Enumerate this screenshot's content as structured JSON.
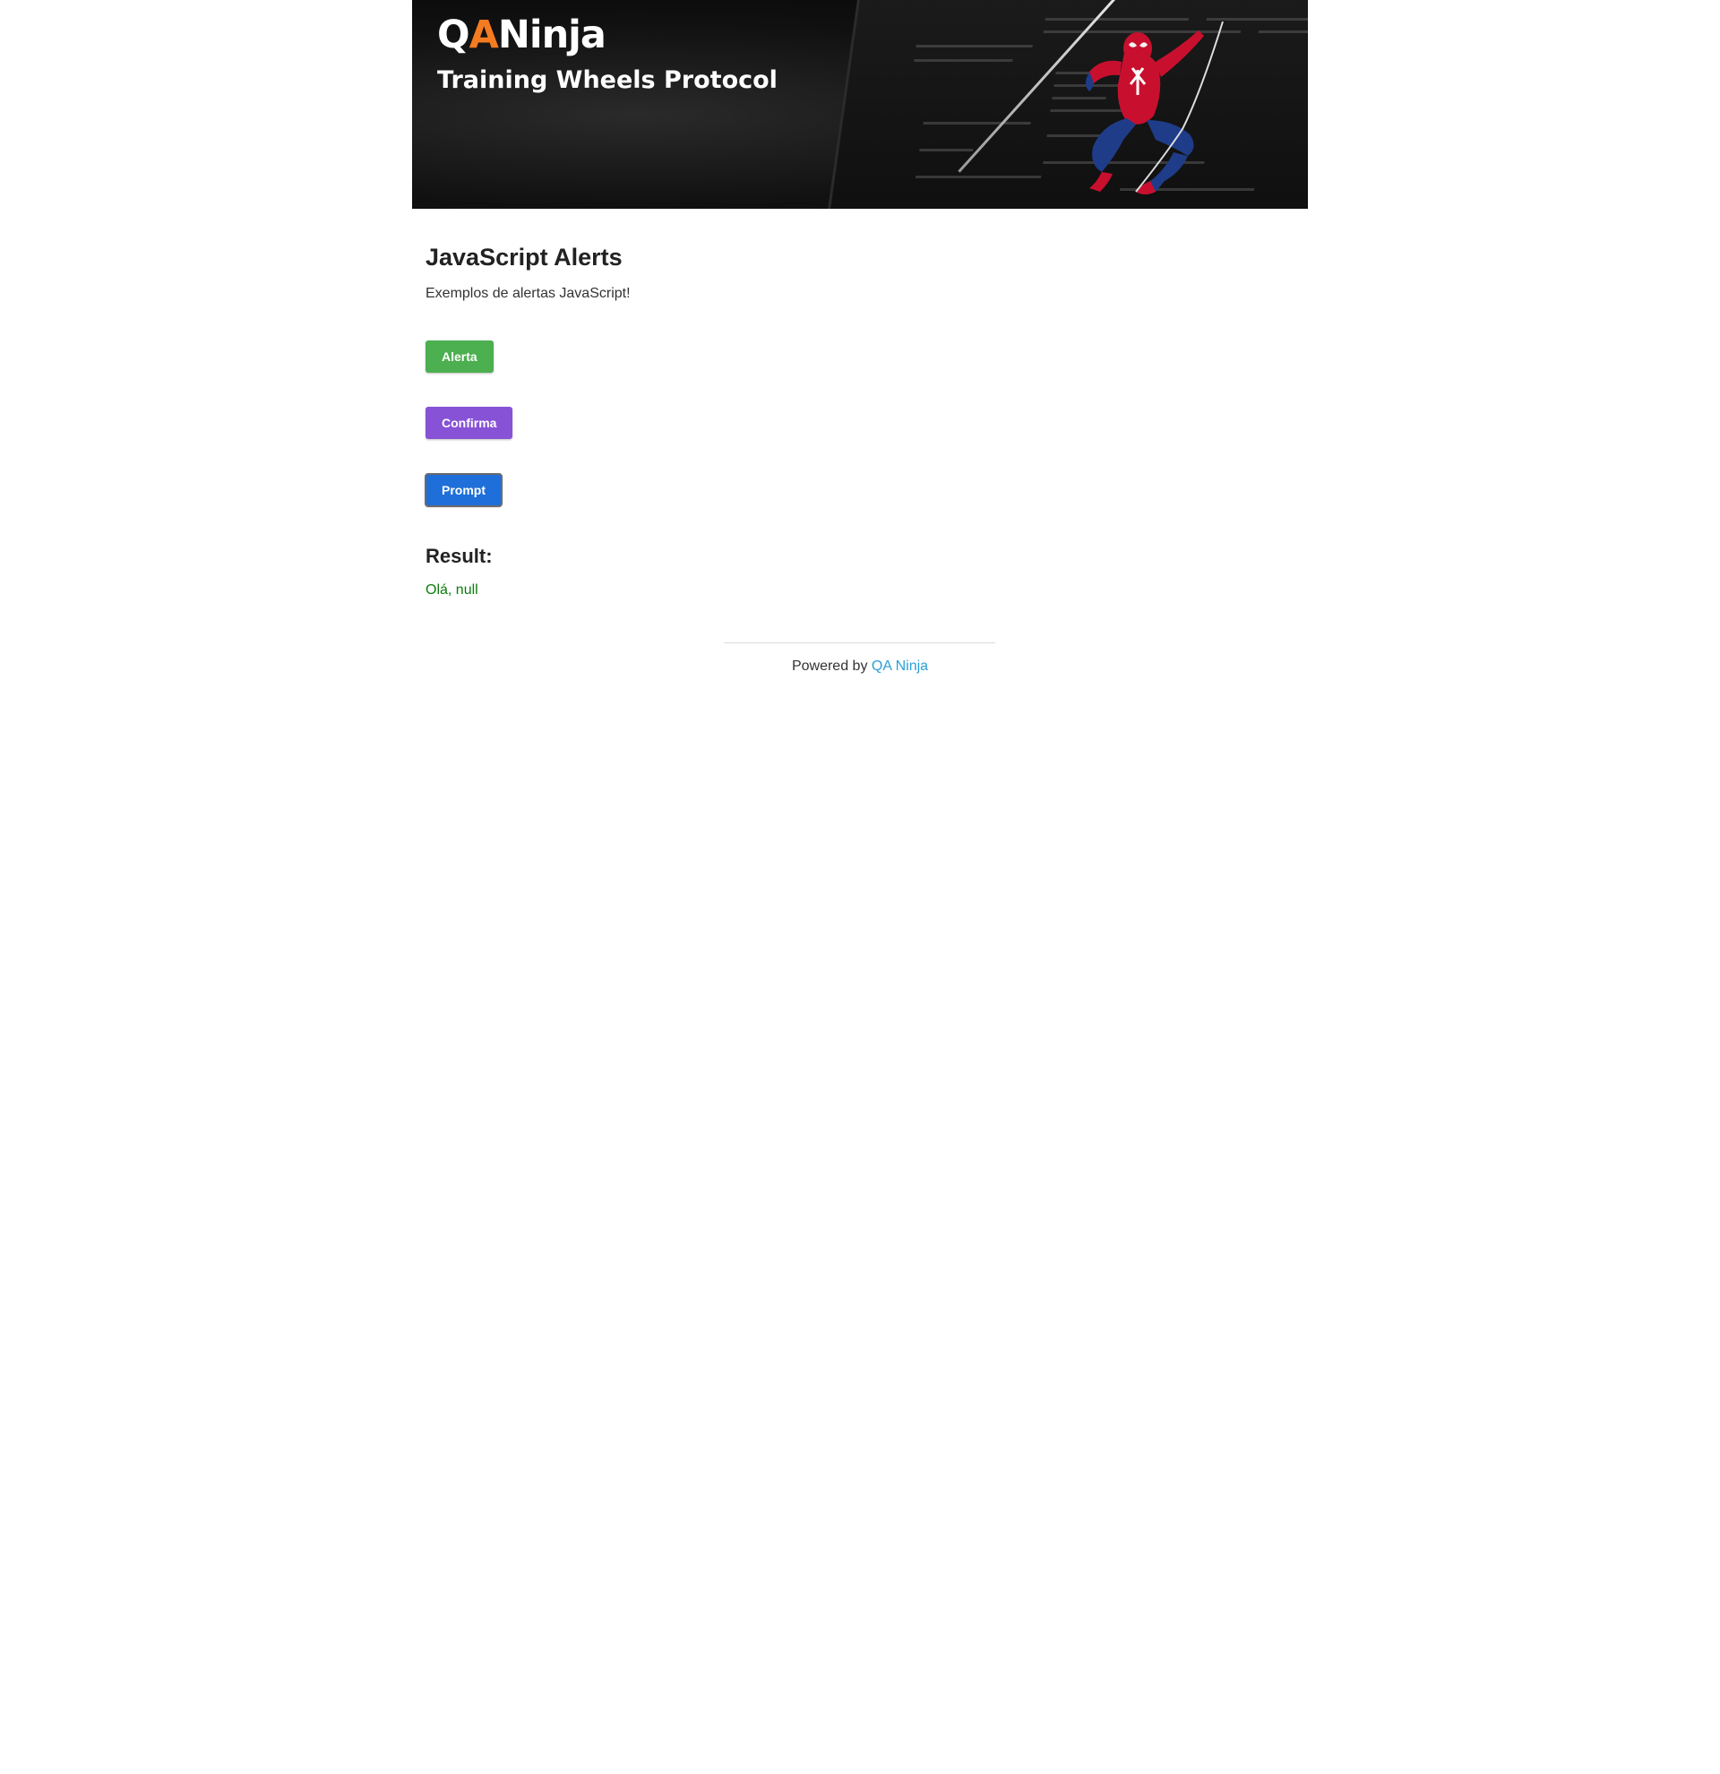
{
  "banner": {
    "logo_prefix": "Q",
    "logo_accent": "A",
    "logo_suffix": "Ninja",
    "subtitle": "Training Wheels Protocol",
    "accent_color": "#f47b20"
  },
  "main": {
    "title": "JavaScript Alerts",
    "description": "Exemplos de alertas JavaScript!",
    "buttons": {
      "alert_label": "Alerta",
      "confirm_label": "Confirma",
      "prompt_label": "Prompt"
    },
    "button_colors": {
      "alert": "#4caf50",
      "confirm": "#8752d6",
      "prompt": "#1e6fd9"
    }
  },
  "result": {
    "title": "Result:",
    "value": "Olá, null",
    "value_color": "#0a7d0a"
  },
  "footer": {
    "powered_by": "Powered by",
    "link_label": "QA Ninja",
    "link_color": "#2a9fd6"
  }
}
